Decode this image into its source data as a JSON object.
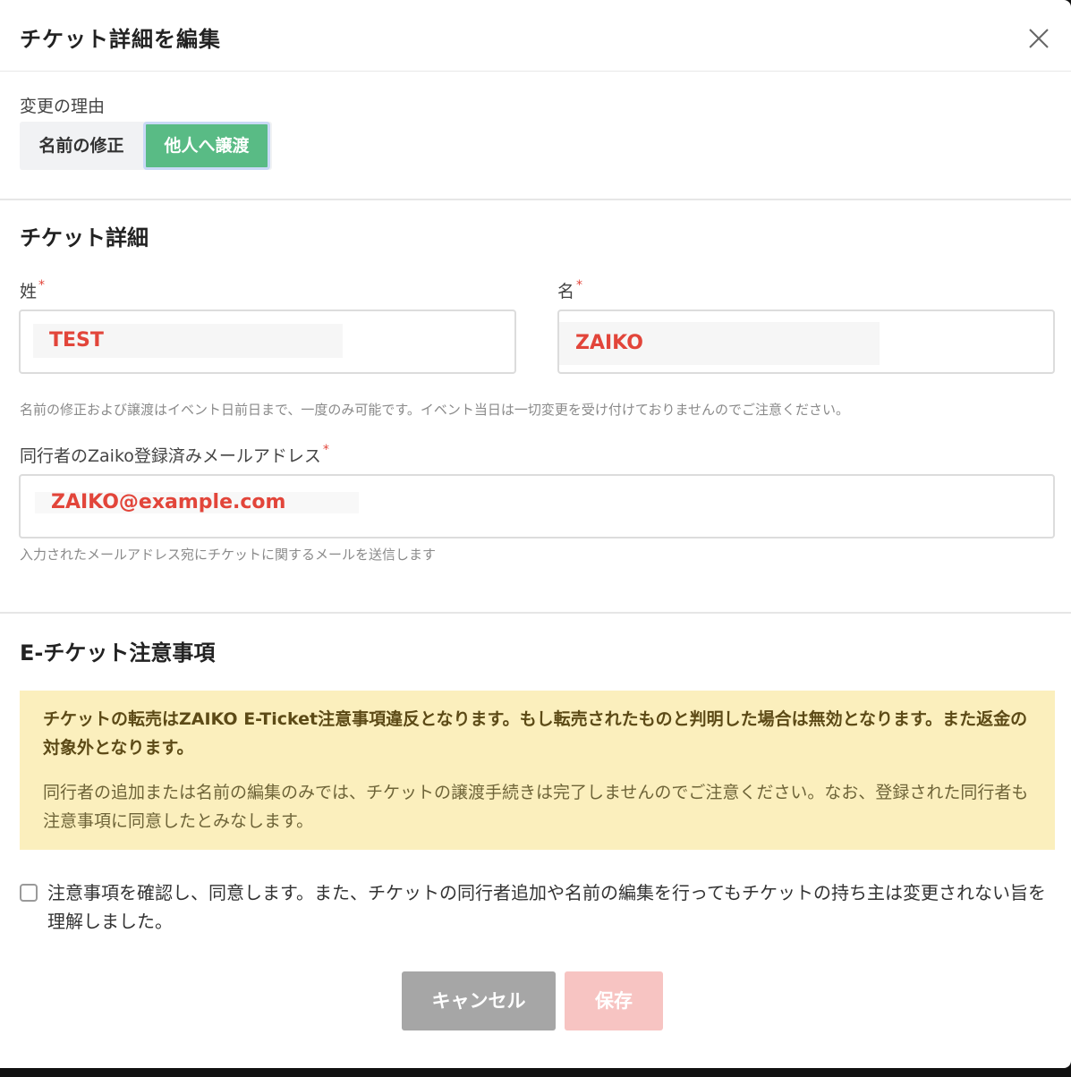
{
  "modal": {
    "title": "チケット詳細を編集",
    "close_icon": "close-icon"
  },
  "reason": {
    "label": "変更の理由",
    "options": [
      "名前の修正",
      "他人へ譲渡"
    ],
    "selected": "他人へ譲渡"
  },
  "ticket_details": {
    "title": "チケット詳細",
    "last_name_label": "姓",
    "last_name_value": "TEST",
    "first_name_label": "名",
    "first_name_value": "ZAIKO",
    "required_mark": "*",
    "name_hint": "名前の修正および譲渡はイベント日前日まで、一度のみ可能です。イベント当日は一切変更を受け付けておりませんのでご注意ください。",
    "email_label": "同行者のZaiko登録済みメールアドレス",
    "email_value": "ZAIKO@example.com",
    "email_hint": "入力されたメールアドレス宛にチケットに関するメールを送信します"
  },
  "eticket_notice": {
    "title": "E-チケット注意事項",
    "strong_text": "チケットの転売はZAIKO E-Ticket注意事項違反となります。もし転売されたものと判明した場合は無効となります。また返金の対象外となります。",
    "normal_text": "同行者の追加または名前の編集のみでは、チケットの譲渡手続きは完了しませんのでご注意ください。なお、登録された同行者も注意事項に同意したとみなします。",
    "agree_text": "注意事項を確認し、同意します。また、チケットの同行者追加や名前の編集を行ってもチケットの持ち主は変更されない旨を理解しました。",
    "agree_checked": false
  },
  "actions": {
    "cancel_label": "キャンセル",
    "save_label": "保存"
  },
  "colors": {
    "accent_green": "#59bb85",
    "error_red": "#e2453a",
    "notice_bg": "#fbefbd",
    "save_disabled": "#f7c4c2",
    "cancel_gray": "#a6a6a6"
  }
}
